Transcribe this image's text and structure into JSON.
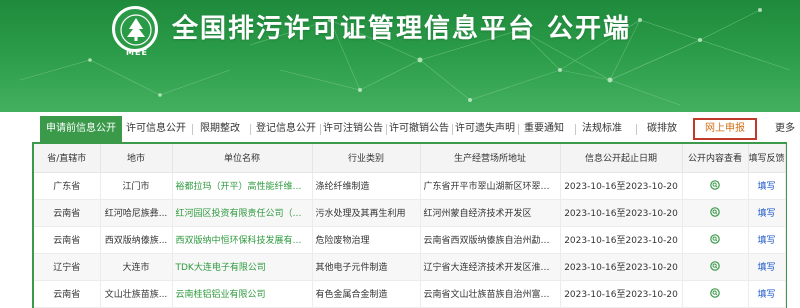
{
  "header": {
    "logo_text": "MEE",
    "title": "全国排污许可证管理信息平台 公开端"
  },
  "nav": {
    "tabs": [
      {
        "label": "申请前信息公开",
        "active": true
      },
      {
        "label": "许可信息公开"
      },
      {
        "label": "限期整改"
      },
      {
        "label": "登记信息公开"
      },
      {
        "label": "许可注销公告"
      },
      {
        "label": "许可撤销公告"
      },
      {
        "label": "许可遗失声明"
      },
      {
        "label": "重要通知"
      },
      {
        "label": "法规标准"
      },
      {
        "label": "碳排放"
      },
      {
        "label": "网上申报",
        "highlighted": true
      },
      {
        "label": "更多"
      }
    ]
  },
  "table": {
    "columns": [
      "省/直辖市",
      "地市",
      "单位名称",
      "行业类别",
      "生产经营场所地址",
      "信息公开起止日期",
      "公开内容查看",
      "填写反馈"
    ],
    "rows": [
      {
        "province": "广东省",
        "city": "江门市",
        "unit": "裕都拉玛（开平）高性能纤维第...",
        "industry": "涤纶纤维制造",
        "address": "广东省开平市翠山湖新区环翠路1...",
        "dates": "2023-10-16至2023-10-20",
        "feedback": "填写"
      },
      {
        "province": "云南省",
        "city": "红河哈尼族彝...",
        "unit": "红河园区投资有限责任公司（蒙...",
        "industry": "污水处理及其再生利用",
        "address": "红河州蒙自经济技术开发区",
        "dates": "2023-10-16至2023-10-20",
        "feedback": "填写"
      },
      {
        "province": "云南省",
        "city": "西双版纳傣族...",
        "unit": "西双版纳中恒环保科技发展有限...",
        "industry": "危险废物治理",
        "address": "云南省西双版纳傣族自治州勐腊...",
        "dates": "2023-10-16至2023-10-20",
        "feedback": "填写"
      },
      {
        "province": "辽宁省",
        "city": "大连市",
        "unit": "TDK大连电子有限公司",
        "industry": "其他电子元件制造",
        "address": "辽宁省大连经济技术开发区淮河...",
        "dates": "2023-10-16至2023-10-20",
        "feedback": "填写"
      },
      {
        "province": "云南省",
        "city": "文山壮族苗族...",
        "unit": "云南桂铝铝业有限公司",
        "industry": "有色金属合金制造",
        "address": "云南省文山壮族苗族自治州富宁...",
        "dates": "2023-10-16至2023-10-20",
        "feedback": "填写"
      }
    ]
  },
  "colors": {
    "brand_green": "#2a9b48",
    "link_blue": "#1a56c8",
    "unit_green": "#2e9a3e",
    "highlight_border": "#c0392b"
  }
}
